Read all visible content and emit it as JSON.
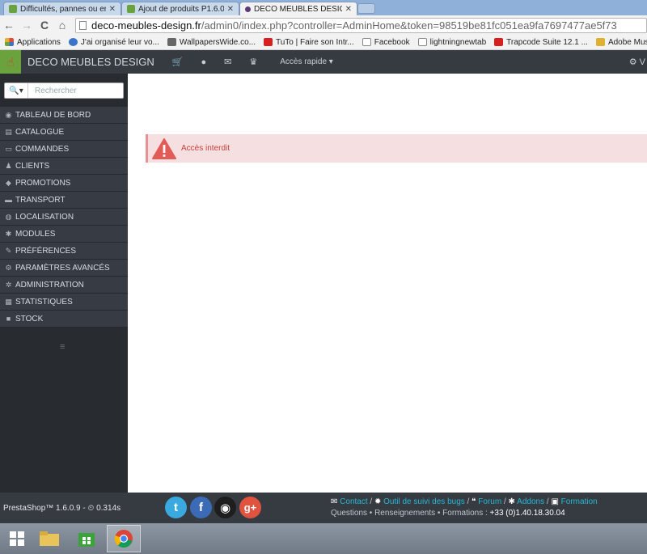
{
  "browser": {
    "tabs": [
      {
        "title": "Difficultés, pannes ou erre",
        "icon_color": "#6aa23e",
        "active": false
      },
      {
        "title": "Ajout de produits P1.6.0.9",
        "icon_color": "#6aa23e",
        "active": false
      },
      {
        "title": "DECO MEUBLES DESIGN",
        "icon_color": "#5b3a78",
        "active": true
      }
    ],
    "nav": {
      "back": "←",
      "forward": "→",
      "reload": "C",
      "home": "⌂"
    },
    "url_host": "deco-meubles-design.fr",
    "url_path": "/admin0/index.php?controller=AdminHome&token=98519be81fc051ea9fa7697477ae5f73",
    "bookmarks": [
      {
        "label": "Applications",
        "icon_color": "#e04a3a"
      },
      {
        "label": "J'ai organisé leur vo...",
        "icon_color": "#3b73c9"
      },
      {
        "label": "WallpapersWide.co...",
        "icon_color": "#666666"
      },
      {
        "label": "TuTo | Faire son Intr...",
        "icon_color": "#d81f1f"
      },
      {
        "label": "Facebook",
        "icon_color": "#ffffff"
      },
      {
        "label": "lightningnewtab",
        "icon_color": "#ffffff"
      },
      {
        "label": "Trapcode Suite 12.1 ...",
        "icon_color": "#d81f1f"
      },
      {
        "label": "Adobe Muse : Les in...",
        "icon_color": "#e0b030"
      }
    ]
  },
  "header": {
    "shop_name": "DECO MEUBLES DESIGN",
    "icons": [
      "cart-icon",
      "user-icon",
      "envelope-icon",
      "trophy-icon"
    ],
    "quick_access": "Accès rapide ▾",
    "right_label": "V"
  },
  "sidebar": {
    "search_placeholder": "Rechercher",
    "search_button": "🔍▾",
    "items": [
      {
        "label": "TABLEAU DE BORD",
        "icon": "◉"
      },
      {
        "label": "CATALOGUE",
        "icon": "▤"
      },
      {
        "label": "COMMANDES",
        "icon": "▭"
      },
      {
        "label": "CLIENTS",
        "icon": "♟"
      },
      {
        "label": "PROMOTIONS",
        "icon": "◆"
      },
      {
        "label": "TRANSPORT",
        "icon": "▬"
      },
      {
        "label": "LOCALISATION",
        "icon": "◍"
      },
      {
        "label": "MODULES",
        "icon": "✱"
      },
      {
        "label": "PRÉFÉRENCES",
        "icon": "✎"
      },
      {
        "label": "PARAMÈTRES AVANCÉS",
        "icon": "⚙"
      },
      {
        "label": "ADMINISTRATION",
        "icon": "✲"
      },
      {
        "label": "STATISTIQUES",
        "icon": "▦"
      },
      {
        "label": "STOCK",
        "icon": "■"
      }
    ],
    "collapse_icon": "≡"
  },
  "alert": {
    "message": "Accès interdit",
    "color": "#c3413d"
  },
  "footer": {
    "version": "PrestaShop™ 1.6.0.9 - ",
    "load_time": "⏲ 0.314s",
    "links": [
      {
        "icon": "✉",
        "label": "Contact"
      },
      {
        "icon": "✹",
        "label": "Outil de suivi des bugs"
      },
      {
        "icon": "❝",
        "label": "Forum"
      },
      {
        "icon": "✱",
        "label": "Addons"
      },
      {
        "icon": "▣",
        "label": "Formation"
      }
    ],
    "separator": " / ",
    "line2_text": "Questions • Renseignements • Formations : ",
    "phone": "+33 (0)1.40.18.30.04",
    "social": [
      {
        "name": "twitter",
        "glyph": "t",
        "color": "#3aa9e0"
      },
      {
        "name": "facebook",
        "glyph": "f",
        "color": "#3b6bb6"
      },
      {
        "name": "github",
        "glyph": "◉",
        "color": "#1e1e1e"
      },
      {
        "name": "google-plus",
        "glyph": "g+",
        "color": "#e0533f"
      }
    ]
  }
}
